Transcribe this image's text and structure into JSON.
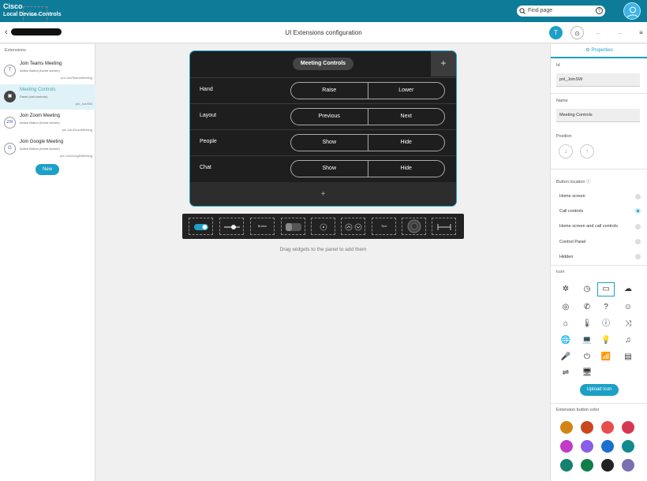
{
  "topbar": {
    "brand_strong": "Cisco",
    "brand_light": " Webex",
    "subtitle": "Local Device Controls",
    "search_placeholder": "Find page",
    "help": "?"
  },
  "header": {
    "title": "UI Extensions configuration",
    "back": "‹"
  },
  "toolbar": {
    "t": "T",
    "eye": "⊙",
    "undo": "←",
    "redo": "→",
    "menu": "≡"
  },
  "extensions": {
    "heading": "Extensions",
    "items": [
      {
        "name": "Join Teams Meeting",
        "sub": "Action Button (home screen)",
        "id": "pnl.JoinTeamsMeeting",
        "icon": "T"
      },
      {
        "name": "Meeting Controls",
        "sub": "Panel (call controls)",
        "id": "pnl_JoinSW",
        "icon": "▣"
      },
      {
        "name": "Join Zoom Meeting",
        "sub": "Action Button (home screen)",
        "id": "pnl.JoinZoomMeeting",
        "icon": "zm"
      },
      {
        "name": "Join Google Meeting",
        "sub": "Action Button (home screen)",
        "id": "pnl.JoinGoogleMeeting",
        "icon": "G"
      }
    ],
    "new_label": "New"
  },
  "panel": {
    "title": "Meeting Controls",
    "plus": "+",
    "add": "+",
    "rows": [
      {
        "label": "Hand",
        "left": "Raise",
        "right": "Lower"
      },
      {
        "label": "Layout",
        "left": "Previous",
        "right": "Next"
      },
      {
        "label": "People",
        "left": "Show",
        "right": "Hide"
      },
      {
        "label": "Chat",
        "left": "Show",
        "right": "Hide"
      }
    ]
  },
  "widgets": {
    "button": "Button",
    "text": "Text",
    "hint": "Drag widgets to the panel to add them"
  },
  "properties": {
    "tab": "⚙ Properties",
    "id_label": "Id",
    "id_value": "pnl_JoinSW",
    "name_label": "Name",
    "name_value": "Meeting Controls",
    "position_label": "Position",
    "down": "↓",
    "up": "↑",
    "location_label": "Button location ⓘ",
    "locations": [
      "Home screen",
      "Call controls",
      "Home screen and call controls",
      "Control Panel",
      "Hidden"
    ],
    "selected_location": 1,
    "icon_label": "Icon",
    "icons": [
      "✲",
      "◷",
      "▭",
      "☁",
      "◎",
      "✆",
      "?",
      "☺",
      "⌂",
      "🌡",
      "ⓘ",
      "⤨",
      "🌐",
      "💻",
      "💡",
      "♫",
      "🎤",
      "⏻",
      "📶",
      "▤",
      "⇌",
      "🖥"
    ],
    "selected_icon": 2,
    "upload_label": "Upload Icon",
    "color_label": "Extension button color",
    "colors": [
      "#d38312",
      "#c9471d",
      "#e84e4b",
      "#d63851",
      "#c13bc6",
      "#8a5ee6",
      "#1a6fcf",
      "#128a8f",
      "#168071",
      "#117d4a",
      "#222222",
      "#7b6fb0"
    ]
  }
}
